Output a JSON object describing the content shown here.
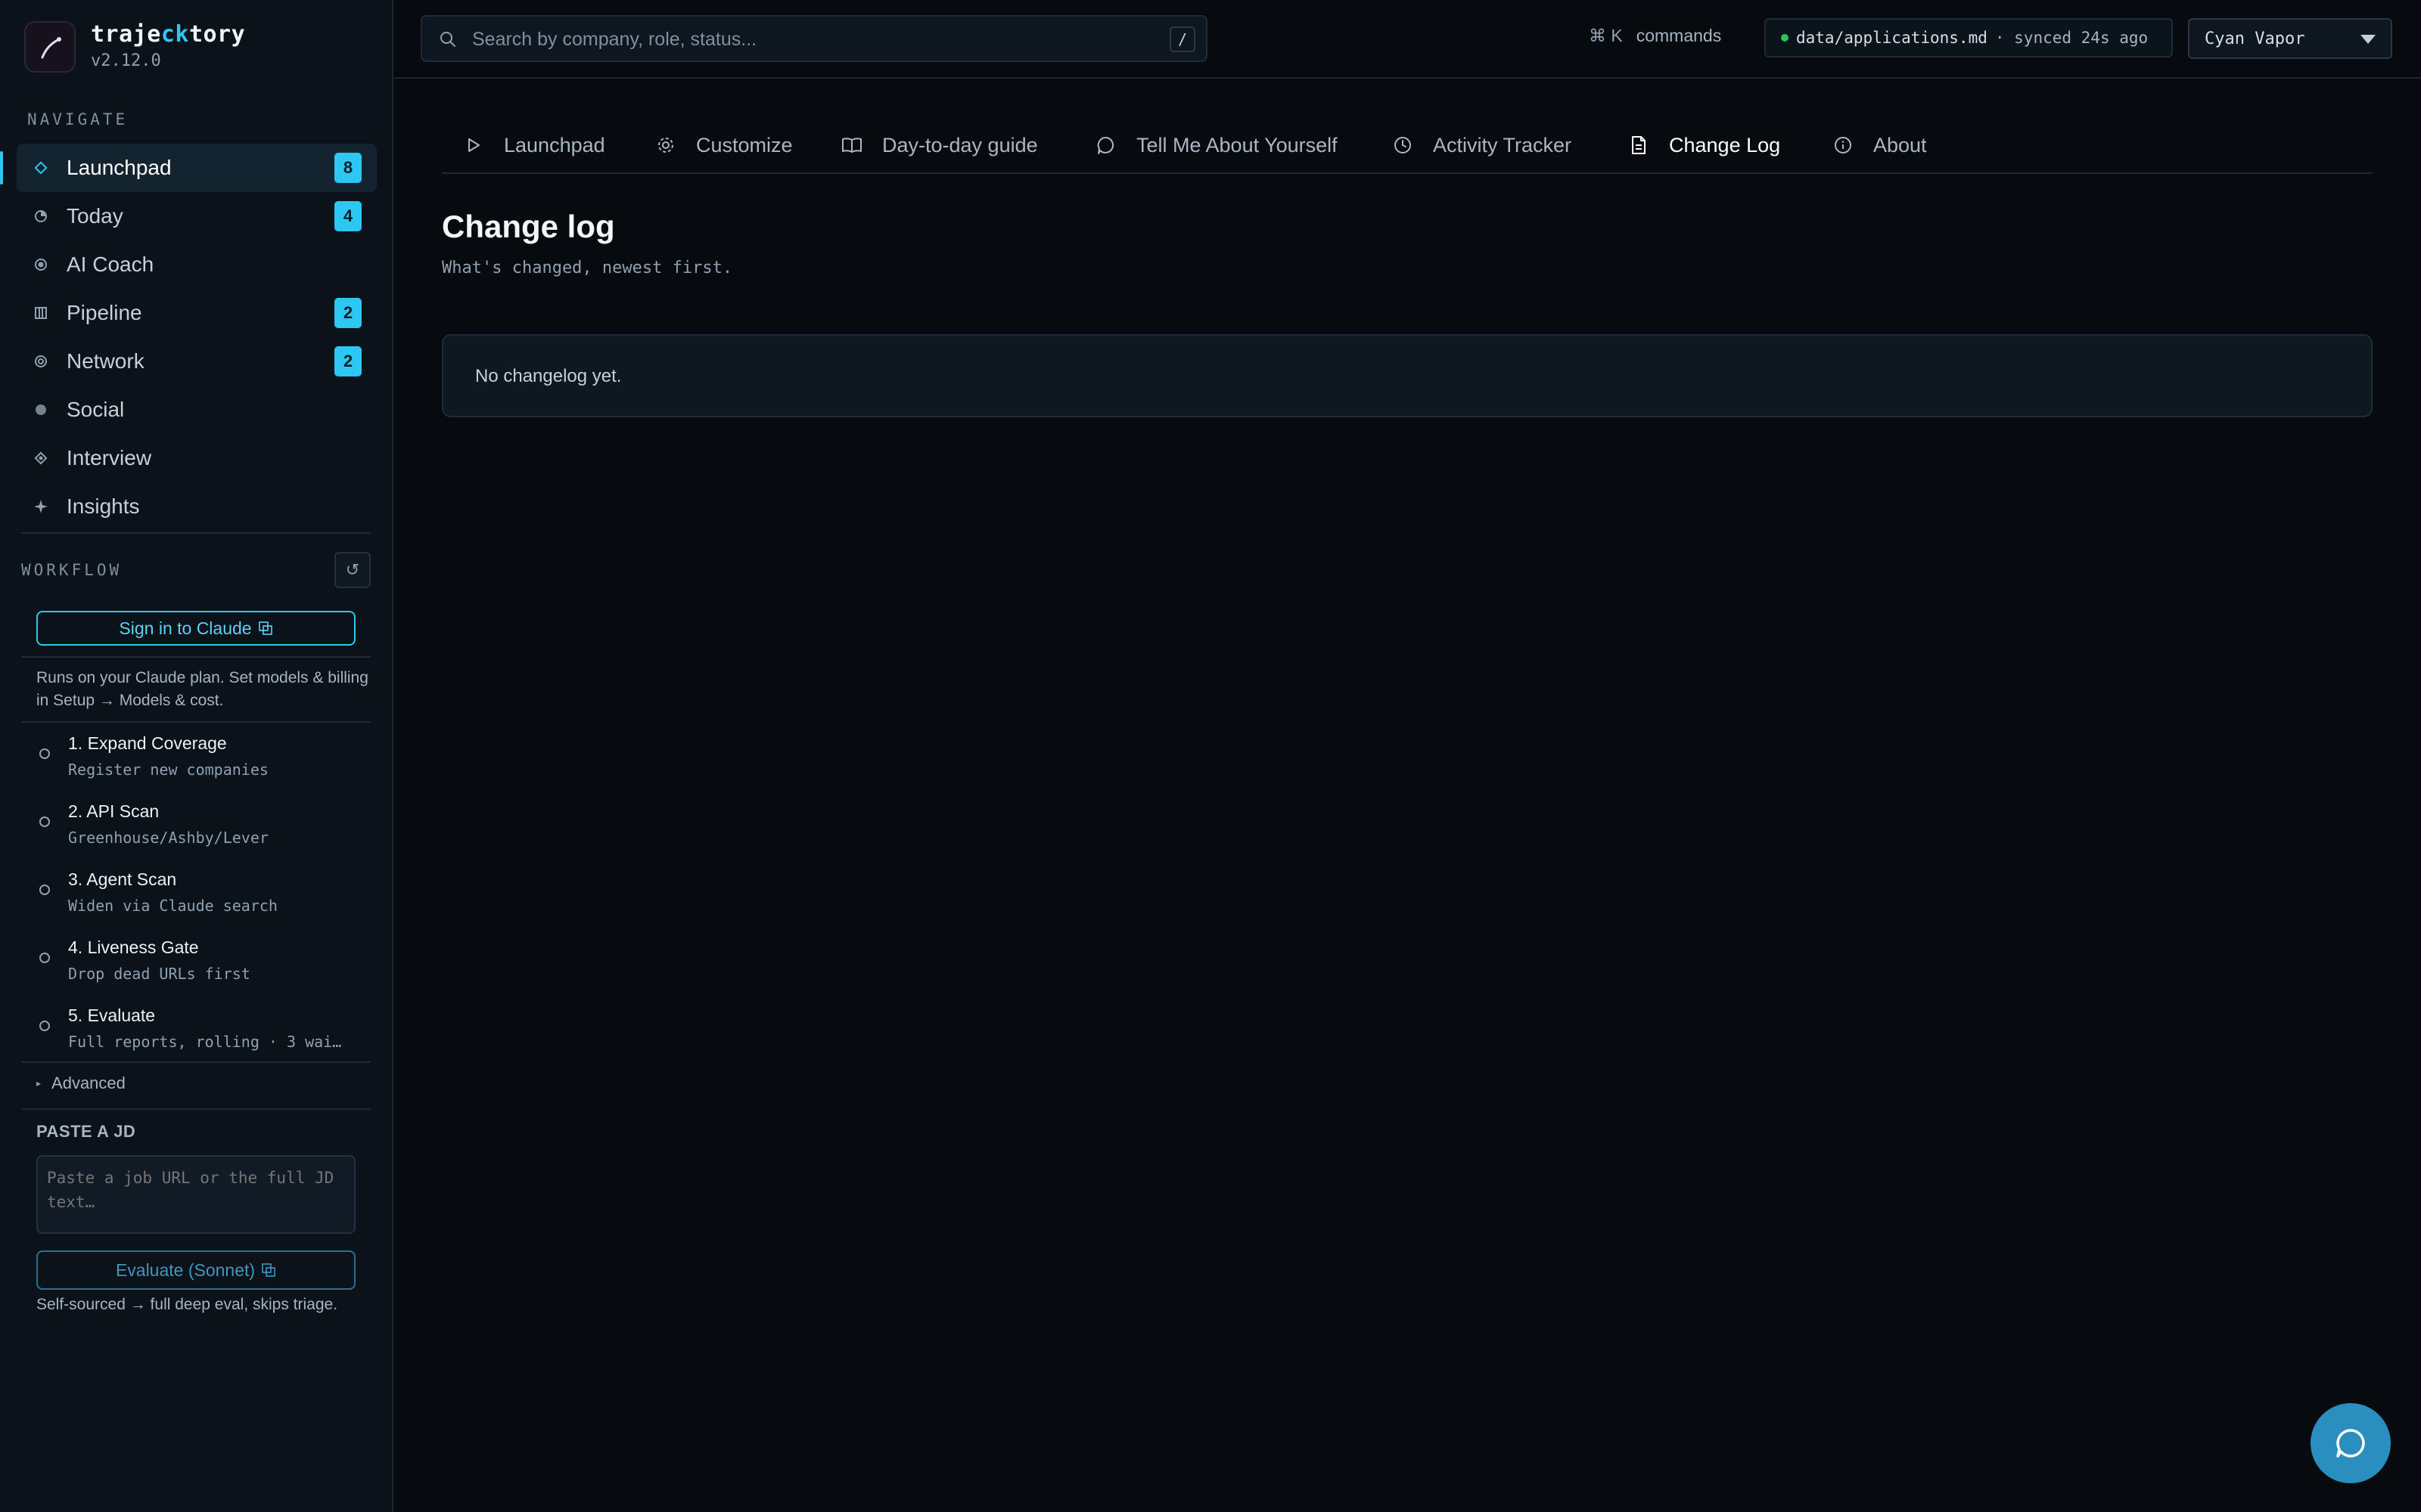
{
  "brand": {
    "name_pre": "traje",
    "name_accent": "ck",
    "name_post": "tory",
    "version": "v2.12.0"
  },
  "nav": {
    "label": "NAVIGATE",
    "items": [
      {
        "label": "Launchpad",
        "badge": "8",
        "icon": "diamond-icon"
      },
      {
        "label": "Today",
        "badge": "4",
        "icon": "clock-icon"
      },
      {
        "label": "AI Coach",
        "badge": "",
        "icon": "target-icon"
      },
      {
        "label": "Pipeline",
        "badge": "2",
        "icon": "columns-icon"
      },
      {
        "label": "Network",
        "badge": "2",
        "icon": "ring-icon"
      },
      {
        "label": "Social",
        "badge": "",
        "icon": "dot-icon"
      },
      {
        "label": "Interview",
        "badge": "",
        "icon": "diamond-dot-icon"
      },
      {
        "label": "Insights",
        "badge": "",
        "icon": "sparkle-icon"
      }
    ]
  },
  "workflow": {
    "label": "WORKFLOW",
    "signin_label": "Sign in to Claude",
    "note": "Runs on your Claude plan. Set models & billing in Setup → Models & cost.",
    "steps": [
      {
        "title": "1. Expand Coverage",
        "sub": "Register new companies"
      },
      {
        "title": "2. API Scan",
        "sub": "Greenhouse/Ashby/Lever"
      },
      {
        "title": "3. Agent Scan",
        "sub": "Widen via Claude search"
      },
      {
        "title": "4. Liveness Gate",
        "sub": "Drop dead URLs first"
      },
      {
        "title": "5. Evaluate",
        "sub": "Full reports, rolling · 3 wai…"
      }
    ],
    "advanced_label": "Advanced",
    "paste_label": "PASTE A JD",
    "paste_placeholder": "Paste a job URL or the full JD text…",
    "evaluate_label": "Evaluate (Sonnet)",
    "evaluate_note": "Self-sourced → full deep eval, skips triage."
  },
  "topbar": {
    "search_placeholder": "Search by company, role, status...",
    "search_shortcut": "/",
    "cmd_key": "⌘ K",
    "cmd_label": "commands",
    "sync_file": "data/applications.md",
    "sync_status": "· synced 24s ago",
    "theme": "Cyan Vapor"
  },
  "tabs": [
    {
      "label": "Launchpad",
      "icon": "play-icon"
    },
    {
      "label": "Customize",
      "icon": "gear-icon"
    },
    {
      "label": "Day-to-day guide",
      "icon": "book-icon"
    },
    {
      "label": "Tell Me About Yourself",
      "icon": "chat-icon"
    },
    {
      "label": "Activity Tracker",
      "icon": "clock-icon"
    },
    {
      "label": "Change Log",
      "icon": "document-icon"
    },
    {
      "label": "About",
      "icon": "info-icon"
    }
  ],
  "main": {
    "title": "Change log",
    "subtitle": "What's changed, newest first.",
    "empty_text": "No changelog yet."
  },
  "colors": {
    "accent": "#2ec6f2",
    "background": "#070b10",
    "sidebar": "#0b121a",
    "sync_dot": "#22c55e"
  }
}
